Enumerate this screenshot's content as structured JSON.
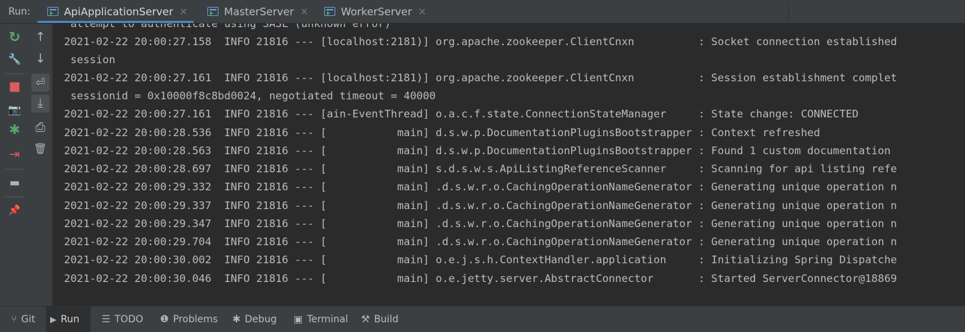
{
  "run_label": "Run:",
  "tabs": [
    {
      "label": "ApiApplicationServer",
      "close": "×"
    },
    {
      "label": "MasterServer",
      "close": "×"
    },
    {
      "label": "WorkerServer",
      "close": "×"
    }
  ],
  "console_lines": [
    " attempt to authenticate using SASL (unknown error)",
    "2021-02-22 20:00:27.158  INFO 21816 --- [localhost:2181)] org.apache.zookeeper.ClientCnxn          : Socket connection established",
    " session",
    "2021-02-22 20:00:27.161  INFO 21816 --- [localhost:2181)] org.apache.zookeeper.ClientCnxn          : Session establishment complet",
    " sessionid = 0x10000f8c8bd0024, negotiated timeout = 40000",
    "2021-02-22 20:00:27.161  INFO 21816 --- [ain-EventThread] o.a.c.f.state.ConnectionStateManager     : State change: CONNECTED",
    "2021-02-22 20:00:28.536  INFO 21816 --- [           main] d.s.w.p.DocumentationPluginsBootstrapper : Context refreshed",
    "2021-02-22 20:00:28.563  INFO 21816 --- [           main] d.s.w.p.DocumentationPluginsBootstrapper : Found 1 custom documentation",
    "2021-02-22 20:00:28.697  INFO 21816 --- [           main] s.d.s.w.s.ApiListingReferenceScanner     : Scanning for api listing refe",
    "2021-02-22 20:00:29.332  INFO 21816 --- [           main] .d.s.w.r.o.CachingOperationNameGenerator : Generating unique operation n",
    "2021-02-22 20:00:29.337  INFO 21816 --- [           main] .d.s.w.r.o.CachingOperationNameGenerator : Generating unique operation n",
    "2021-02-22 20:00:29.347  INFO 21816 --- [           main] .d.s.w.r.o.CachingOperationNameGenerator : Generating unique operation n",
    "2021-02-22 20:00:29.704  INFO 21816 --- [           main] .d.s.w.r.o.CachingOperationNameGenerator : Generating unique operation n",
    "2021-02-22 20:00:30.002  INFO 21816 --- [           main] o.e.j.s.h.ContextHandler.application     : Initializing Spring Dispatche",
    "2021-02-22 20:00:30.046  INFO 21816 --- [           main] o.e.jetty.server.AbstractConnector       : Started ServerConnector@18869"
  ],
  "left_toolbar": [
    {
      "icon": "rerun-icon",
      "glyph": "↻",
      "color": "#59a869"
    },
    {
      "icon": "wrench-icon",
      "glyph": "🔧",
      "color": "#afb1b3"
    },
    {
      "icon": "stop-icon",
      "glyph": "■",
      "color": "#db5c5c"
    },
    {
      "icon": "camera-icon",
      "glyph": "📷",
      "color": "#afb1b3"
    },
    {
      "icon": "debug-bug-icon",
      "glyph": "✱",
      "color": "#59a869"
    },
    {
      "icon": "exit-icon",
      "glyph": "⇥",
      "color": "#db5c5c"
    },
    {
      "icon": "layout-icon",
      "glyph": "▬",
      "color": "#afb1b3"
    },
    {
      "icon": "pin-icon",
      "glyph": "📌",
      "color": "#afb1b3"
    }
  ],
  "console_toolbar": [
    {
      "icon": "arrow-up-icon",
      "glyph": "↑"
    },
    {
      "icon": "arrow-down-icon",
      "glyph": "↓"
    },
    {
      "icon": "soft-wrap-icon",
      "glyph": "⏎"
    },
    {
      "icon": "scroll-to-end-icon",
      "glyph": "⤓"
    },
    {
      "icon": "print-icon",
      "glyph": "⎙"
    },
    {
      "icon": "trash-icon",
      "glyph": "🗑"
    }
  ],
  "bottom_tabs": [
    {
      "label": "Git",
      "icon": "git-branch-icon",
      "glyph": "⑂"
    },
    {
      "label": "Run",
      "icon": "run-icon",
      "glyph": "▶"
    },
    {
      "label": "TODO",
      "icon": "todo-list-icon",
      "glyph": "☰"
    },
    {
      "label": "Problems",
      "icon": "problems-icon",
      "glyph": "❶"
    },
    {
      "label": "Debug",
      "icon": "debug-icon",
      "glyph": "✱"
    },
    {
      "label": "Terminal",
      "icon": "terminal-icon",
      "glyph": "▣"
    },
    {
      "label": "Build",
      "icon": "build-hammer-icon",
      "glyph": "⚒"
    }
  ],
  "colors": {
    "accent": "#4a88c7",
    "console_bg": "#2b2b2b",
    "panel_bg": "#3c3f41",
    "text": "#bbbbbb"
  }
}
